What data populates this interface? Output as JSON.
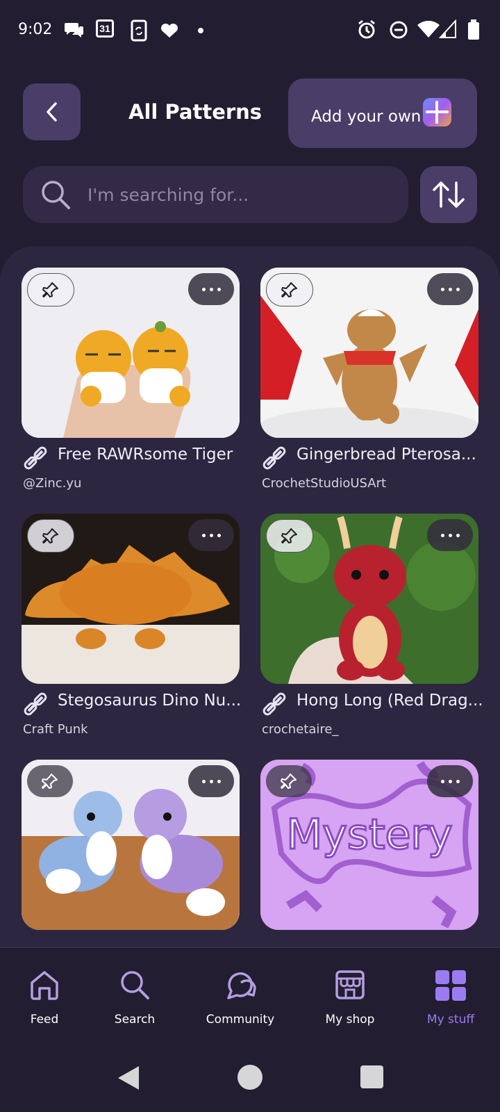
{
  "status_bar": {
    "time": "9:02",
    "calendar_day": "31"
  },
  "header": {
    "title": "All Patterns",
    "add_label": "Add your own"
  },
  "search": {
    "placeholder": "I'm searching for..."
  },
  "patterns": [
    {
      "title": "Free RAWRsome Tiger",
      "author": "@Zinc.yu"
    },
    {
      "title": "Gingerbread Pterosa...",
      "author": "CrochetStudioUSArt"
    },
    {
      "title": "Stegosaurus Dino Nu...",
      "author": "Craft Punk"
    },
    {
      "title": "Hong Long (Red Drag...",
      "author": "crochetaire_"
    },
    {
      "title": "",
      "author": ""
    },
    {
      "title": "",
      "author": ""
    }
  ],
  "mystery_text": "Mystery",
  "nav": {
    "items": [
      {
        "label": "Feed",
        "icon": "home-icon"
      },
      {
        "label": "Search",
        "icon": "search-icon"
      },
      {
        "label": "Community",
        "icon": "chat-icon"
      },
      {
        "label": "My shop",
        "icon": "shop-icon"
      },
      {
        "label": "My stuff",
        "icon": "grid-icon"
      }
    ],
    "active": "My stuff",
    "active_color": "#9b7cf0"
  }
}
